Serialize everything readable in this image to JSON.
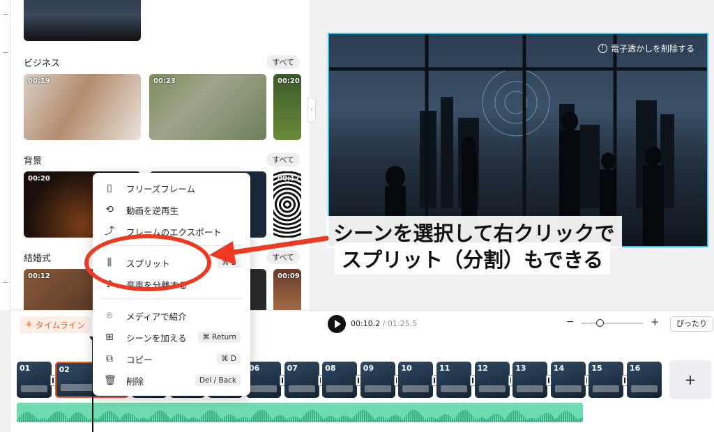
{
  "media_panel": {
    "sections": [
      {
        "title": "ビジネス",
        "all_label": "すべて",
        "durations": [
          "00:19",
          "00:23",
          "00:20"
        ]
      },
      {
        "title": "背景",
        "all_label": "すべて",
        "durations": [
          "00:20",
          "",
          "00:17"
        ]
      },
      {
        "title": "結婚式",
        "all_label": "すべて",
        "durations": [
          "00:12",
          "",
          "00:09"
        ]
      }
    ]
  },
  "preview": {
    "watermark_label": "電子透かしを削除する",
    "annotation_line1": "シーンを選択して右クリックで",
    "annotation_line2": "スプリット（分割）もできる"
  },
  "context_menu": {
    "items": [
      {
        "label": "フリーズフレーム",
        "icon": "freeze-frame-icon",
        "shortcut": ""
      },
      {
        "label": "動画を逆再生",
        "icon": "reverse-icon",
        "shortcut": ""
      },
      {
        "label": "フレームのエクスポート",
        "icon": "export-frame-icon",
        "shortcut": ""
      },
      {
        "label": "スプリット",
        "icon": "split-icon",
        "shortcut": "⌘ B"
      },
      {
        "label": "音声を分離する",
        "icon": "detach-audio-icon",
        "shortcut": ""
      },
      {
        "label": "メディアで紹介",
        "icon": "location-pin-icon",
        "shortcut": ""
      },
      {
        "label": "シーンを加える",
        "icon": "add-scene-icon",
        "shortcut": "⌘ Return"
      },
      {
        "label": "コピー",
        "icon": "copy-icon",
        "shortcut": "⌘ D"
      },
      {
        "label": "削除",
        "icon": "trash-icon",
        "shortcut": "Del / Back"
      }
    ]
  },
  "toolbar": {
    "timeline_tab": "タイムライン",
    "current_time": "00:10.2",
    "separator": " / ",
    "total_time": "01:25.5",
    "zoom_minus": "−",
    "zoom_plus": "+",
    "fit_label": "ぴったり",
    "zoom_level": 0.3
  },
  "timeline": {
    "scenes": [
      "01",
      "02",
      "03",
      "04",
      "05",
      "06",
      "07",
      "08",
      "09",
      "10",
      "11",
      "12",
      "13",
      "14",
      "15",
      "16"
    ],
    "selected_scene": "02",
    "add_label": "+"
  },
  "colors": {
    "accent_orange": "#e8622c",
    "callout_red": "#ee3a22",
    "preview_border": "#33c6e8",
    "audio_track": "#6fdcb0"
  }
}
